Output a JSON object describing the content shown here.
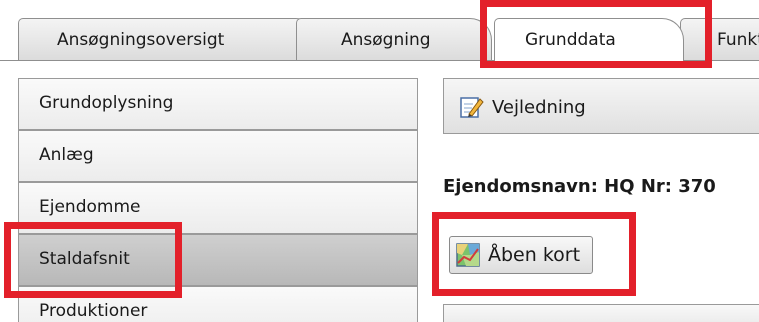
{
  "tabs": [
    {
      "label": "Ansøgningsoversigt"
    },
    {
      "label": "Ansøgning"
    },
    {
      "label": "Grunddata"
    },
    {
      "label": "Funktioner"
    }
  ],
  "sidebar": {
    "items": [
      {
        "label": "Grundoplysning"
      },
      {
        "label": "Anlæg"
      },
      {
        "label": "Ejendomme"
      },
      {
        "label": "Staldafsnit"
      },
      {
        "label": "Produktioner"
      }
    ]
  },
  "toolbar": {
    "guidance_label": "Vejledning",
    "icon": "pencil-icon"
  },
  "main": {
    "property_name": "Ejendomsnavn: HQ Nr: 370",
    "open_map_label": "Åben kort",
    "open_map_icon": "map-icon"
  },
  "colors": {
    "highlight": "#e3202a"
  }
}
